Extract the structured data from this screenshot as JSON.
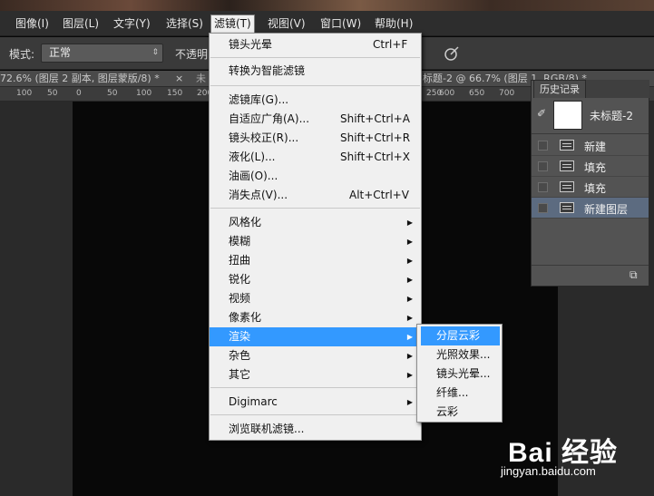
{
  "menubar": {
    "items": [
      "图像(I)",
      "图层(L)",
      "文字(Y)",
      "选择(S)",
      "滤镜(T)",
      "视图(V)",
      "窗口(W)",
      "帮助(H)"
    ],
    "active": "滤镜(T)"
  },
  "options_bar": {
    "mode_label": "模式:",
    "mode_value": "正常",
    "opacity_label": "不透明"
  },
  "tabs": {
    "tab1": "72.6% (图层 2 副本, 图层蒙版/8) *",
    "tab1_close": "×",
    "tab2_prefix": "未",
    "tab3": "标题-2 @ 66.7% (图层 1, RGB/8) *"
  },
  "ruler": {
    "ticks": [
      "100",
      "50",
      "0",
      "50",
      "100",
      "150",
      "200",
      "250",
      "600",
      "650",
      "700"
    ]
  },
  "filter_menu": {
    "items": [
      {
        "label": "镜头光晕",
        "shortcut": "Ctrl+F"
      },
      {
        "label": "转换为智能滤镜"
      },
      {
        "label": "滤镜库(G)..."
      },
      {
        "label": "自适应广角(A)...",
        "shortcut": "Shift+Ctrl+A"
      },
      {
        "label": "镜头校正(R)...",
        "shortcut": "Shift+Ctrl+R"
      },
      {
        "label": "液化(L)...",
        "shortcut": "Shift+Ctrl+X"
      },
      {
        "label": "油画(O)..."
      },
      {
        "label": "消失点(V)...",
        "shortcut": "Alt+Ctrl+V"
      },
      {
        "label": "风格化",
        "submenu": true
      },
      {
        "label": "模糊",
        "submenu": true
      },
      {
        "label": "扭曲",
        "submenu": true
      },
      {
        "label": "锐化",
        "submenu": true
      },
      {
        "label": "视频",
        "submenu": true
      },
      {
        "label": "像素化",
        "submenu": true
      },
      {
        "label": "渲染",
        "submenu": true,
        "highlighted": true
      },
      {
        "label": "杂色",
        "submenu": true
      },
      {
        "label": "其它",
        "submenu": true
      },
      {
        "label": "Digimarc",
        "submenu": true
      },
      {
        "label": "浏览联机滤镜..."
      }
    ]
  },
  "render_submenu": {
    "items": [
      "分层云彩",
      "光照效果...",
      "镜头光晕...",
      "纤维...",
      "云彩"
    ],
    "highlighted": "分层云彩"
  },
  "history_panel": {
    "tab_label": "历史记录",
    "snapshot_label": "未标题-2",
    "states": [
      "新建",
      "填充",
      "填充",
      "新建图层"
    ],
    "selected_state": "新建图层"
  },
  "watermark": {
    "logo": "Bai 经验",
    "url": "jingyan.baidu.com"
  },
  "colors": {
    "highlight": "#3399ff",
    "history_selected": "#5c6b80"
  }
}
